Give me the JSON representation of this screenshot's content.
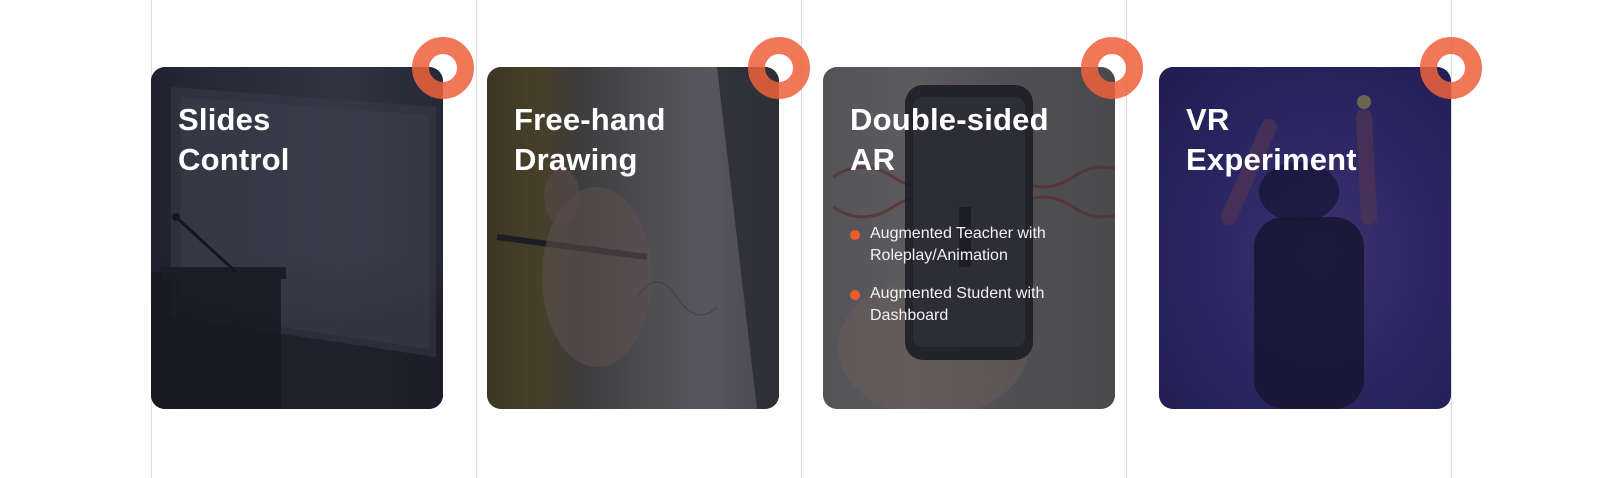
{
  "colors": {
    "accent": "#f15a29",
    "ring": "#ee623c",
    "card_overlay": "#1f2130",
    "title_text": "#ffffff"
  },
  "cards": [
    {
      "title_line1": "Slides",
      "title_line2": "Control",
      "image": "presentation-screen-photo"
    },
    {
      "title_line1": "Free-hand",
      "title_line2": "Drawing",
      "image": "hand-drawing-photo"
    },
    {
      "title_line1": "Double-sided",
      "title_line2": "AR",
      "image": "phone-ar-photo",
      "bullets": [
        "Augmented Teacher with Roleplay/Animation",
        "Augmented Student with Dashboard"
      ]
    },
    {
      "title_line1": "VR",
      "title_line2": "Experiment",
      "image": "vr-headset-photo"
    }
  ]
}
